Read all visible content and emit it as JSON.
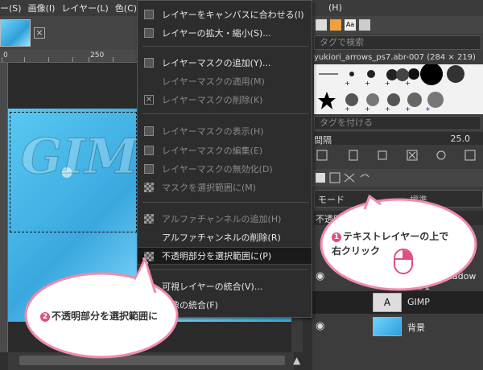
{
  "menubar": {
    "items": [
      "ー(S)",
      "画像(I)",
      "レイヤー(L)",
      "色(C)"
    ]
  },
  "ruler": {
    "ticks": [
      "0",
      "250"
    ]
  },
  "canvas": {
    "text": "GIMP"
  },
  "context_menu": {
    "items": [
      {
        "label": "レイヤーをキャンバスに合わせる(I)",
        "disabled": false
      },
      {
        "label": "レイヤーの拡大・縮小(S)...",
        "disabled": false
      },
      {
        "label": "レイヤーマスクの追加(Y)...",
        "disabled": false
      },
      {
        "label": "レイヤーマスクの適用(M)",
        "disabled": true
      },
      {
        "label": "レイヤーマスクの削除(K)",
        "disabled": true
      },
      {
        "label": "レイヤーマスクの表示(H)",
        "disabled": true
      },
      {
        "label": "レイヤーマスクの編集(E)",
        "disabled": true
      },
      {
        "label": "レイヤーマスクの無効化(D)",
        "disabled": true
      },
      {
        "label": "マスクを選択範囲に(M)",
        "disabled": true
      },
      {
        "label": "アルファチャンネルの追加(H)",
        "disabled": true
      },
      {
        "label": "アルファチャンネルの削除(R)",
        "disabled": false
      },
      {
        "label": "不透明部分を選択範囲に(P)",
        "disabled": false,
        "highlighted": true
      },
      {
        "label": "可視レイヤーの統合(V)...",
        "disabled": false
      },
      {
        "label": "画像の統合(F)",
        "disabled": false
      }
    ]
  },
  "right_panel": {
    "menu_label": "(H)",
    "tag_search_placeholder": "タグで検索",
    "brush_name": "yukiori_arrows_ps7.abr-007 (284 × 219)",
    "tag_add_placeholder": "タグを付ける",
    "spacing_label": "間隔",
    "spacing_value": "25.0",
    "mode_label": "モード",
    "mode_value": "標準",
    "opacity_label": "不透明",
    "layers": [
      {
        "name": "Drop Shadow #1"
      },
      {
        "name": "GIMP"
      },
      {
        "name": "背景"
      }
    ]
  },
  "callouts": {
    "step1": {
      "num": "❶",
      "text_line1": "テキストレイヤーの上で",
      "text_line2": "右クリック"
    },
    "step2": {
      "num": "❷",
      "text": "不透明部分を選択範囲に"
    }
  },
  "colors": {
    "bubble_border": "#f28aa9",
    "highlight": "#1a1a1a",
    "accent": "#e0507d"
  }
}
